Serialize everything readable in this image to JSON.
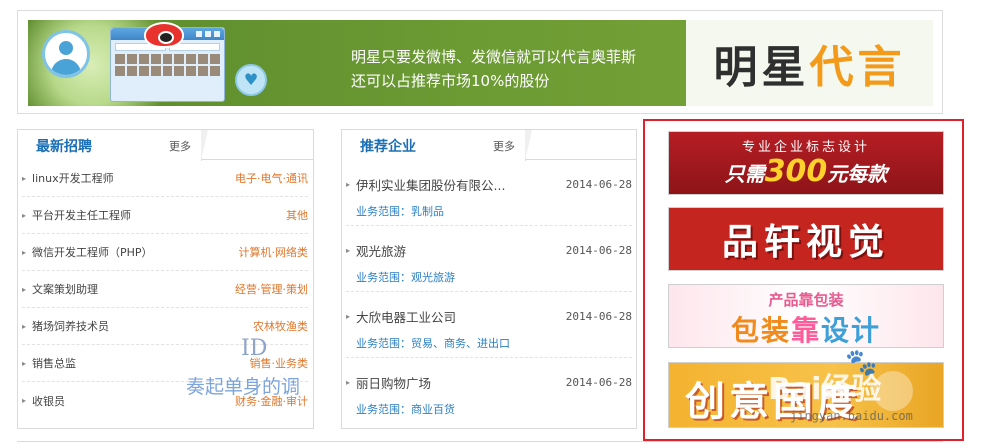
{
  "banner": {
    "line1": "明星只要发微博、发微信就可以代言奥菲斯",
    "line2": "还可以占推荐市场10%的股份",
    "brand_part1": "明星",
    "brand_part2": "代言"
  },
  "jobs_panel": {
    "title": "最新招聘",
    "more": "更多",
    "items": [
      {
        "title": "linux开发工程师",
        "category": "电子·电气·通讯"
      },
      {
        "title": "平台开发主任工程师",
        "category": "其他"
      },
      {
        "title": "微信开发工程师（PHP）",
        "category": "计算机·网络类"
      },
      {
        "title": "文案策划助理",
        "category": "经营·管理·策划"
      },
      {
        "title": "猪场饲养技术员",
        "category": "农林牧渔类"
      },
      {
        "title": "销售总监",
        "category": "销售·业务类"
      },
      {
        "title": "收银员",
        "category": "财务·金融·审计"
      }
    ]
  },
  "enterprise_panel": {
    "title": "推荐企业",
    "more": "更多",
    "items": [
      {
        "name": "伊利实业集团股份有限公...",
        "date": "2014-06-28",
        "scope": "业务范围：乳制品"
      },
      {
        "name": "观光旅游",
        "date": "2014-06-28",
        "scope": "业务范围：观光旅游"
      },
      {
        "name": "大欣电器工业公司",
        "date": "2014-06-28",
        "scope": "业务范围：贸易、商务、进出口"
      },
      {
        "name": "丽日购物广场",
        "date": "2014-06-28",
        "scope": "业务范围：商业百货"
      }
    ]
  },
  "ads": {
    "ad1_line1": "专业企业标志设计",
    "ad1_pre": "只需",
    "ad1_num": "300",
    "ad1_post": "元每款",
    "ad2_text": "品轩视觉",
    "ad3_line1": "产品靠包装",
    "ad3_a": "包装",
    "ad3_b": "靠",
    "ad3_c": "设计",
    "ad4_text": "创意国度"
  },
  "watermarks": {
    "id_mark": "ID",
    "text_mark": "奏起单身的调",
    "baidu_mark": "Bai经验",
    "paw": "🐾",
    "url_mark": "jingyan.baidu.com"
  },
  "icons": {
    "arrow": "▸",
    "heart": "♥"
  },
  "colors": {
    "banner_green": "#6e9c34",
    "title_blue": "#1b6fb5",
    "category_orange": "#e0762a",
    "scope_blue": "#2a7fc2",
    "highlight_red": "#e0202a"
  }
}
